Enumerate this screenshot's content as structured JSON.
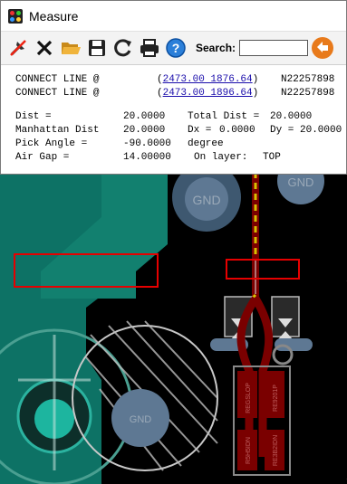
{
  "window": {
    "title": "Measure"
  },
  "toolbar": {
    "buttons": [
      {
        "name": "pin-icon"
      },
      {
        "name": "close-x-icon"
      },
      {
        "name": "folder-icon"
      },
      {
        "name": "save-icon"
      },
      {
        "name": "refresh-icon"
      },
      {
        "name": "print-icon"
      },
      {
        "name": "help-icon"
      }
    ],
    "search_label": "Search:",
    "search_value": "",
    "go_icon": "arrow-left-circle-icon"
  },
  "report": {
    "connect1": {
      "label": "CONNECT LINE @",
      "coord": "2473.00 1876.64",
      "net": "N22257898"
    },
    "connect2": {
      "label": "CONNECT LINE @",
      "coord": "2473.00 1896.64",
      "net": "N22257898"
    },
    "dist": {
      "label": "Dist =",
      "value": "20.0000",
      "total_label": "Total Dist =",
      "total_value": "20.0000"
    },
    "manhattan": {
      "label": "Manhattan Dist",
      "value": "20.0000",
      "dx_label": "Dx =",
      "dx": "0.0000",
      "dy_label": "Dy =",
      "dy": "20.0000"
    },
    "pick": {
      "label": "Pick Angle =",
      "value": "-90.0000",
      "unit": "degree"
    },
    "airgap": {
      "label": "Air Gap =",
      "value": "14.00000",
      "layer_label": "On layer:",
      "layer": "TOP"
    }
  },
  "pcb": {
    "pads": [
      "GND",
      "GND",
      "GND",
      "REGSLOP",
      "RE9201P",
      "R5H5IDN",
      "RE3B2IDN"
    ]
  },
  "colors": {
    "copper": "#0d7265",
    "copper_light": "#1a9a86",
    "pad": "#5e7893",
    "trace_red": "#7a0000",
    "annotation_red": "#e60000",
    "dashed_yellow": "#d8c200"
  }
}
